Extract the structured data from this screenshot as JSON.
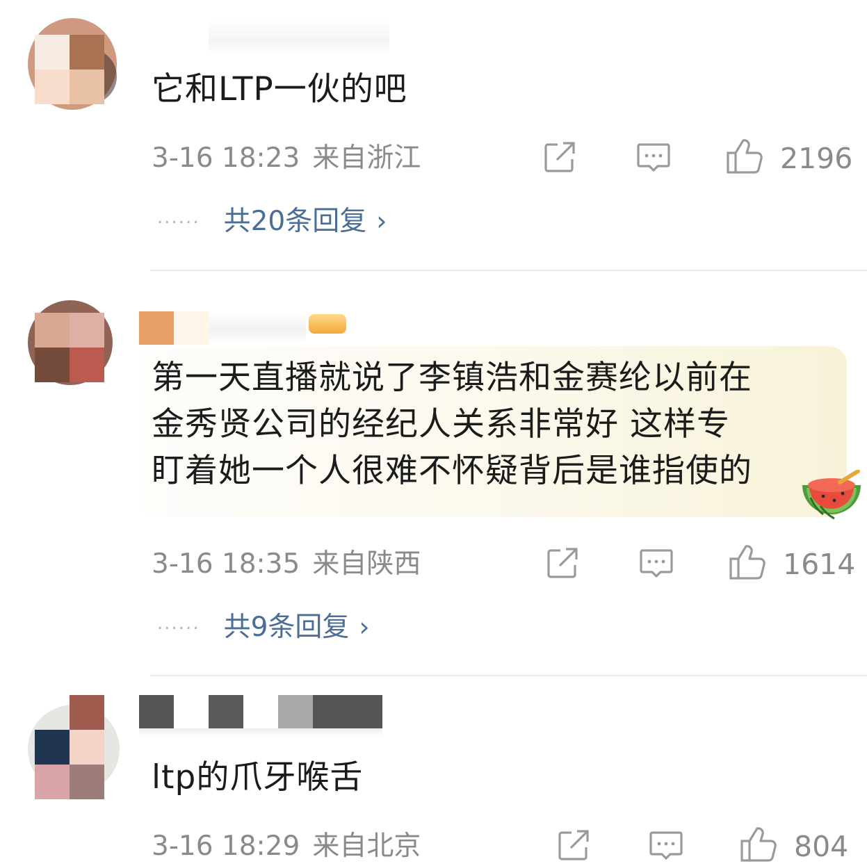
{
  "comments": [
    {
      "username": "",
      "text": "它和LTP一伙的吧",
      "time": "3-16 18:23",
      "location": "来自浙江",
      "likes": "2196",
      "replies": "共20条回复"
    },
    {
      "username": "",
      "text_lines": [
        "第一天直播就说了李镇浩和金赛纶以前在",
        "金秀贤公司的经纪人关系非常好 这样专",
        "盯着她一个人很难不怀疑背后是谁指使的"
      ],
      "time": "3-16 18:35",
      "location": "来自陕西",
      "likes": "1614",
      "replies": "共9条回复"
    },
    {
      "username": "",
      "text": "ltp的爪牙喉舌",
      "time": "3-16 18:29",
      "location": "来自北京",
      "likes": "804"
    }
  ],
  "ui": {
    "dots": "······",
    "chevron": "›"
  },
  "icons": [
    "share-icon",
    "comment-icon",
    "like-icon",
    "watermelon-sticker-icon",
    "badge-icon"
  ],
  "colors": {
    "link": "#4a6e95",
    "meta": "#8a8a8a",
    "divider": "#ececec"
  }
}
